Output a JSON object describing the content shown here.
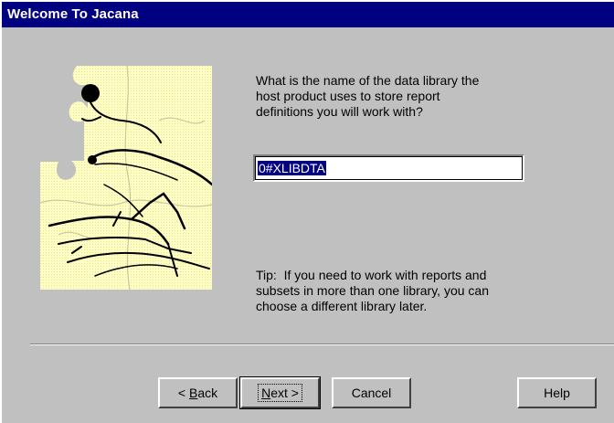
{
  "window": {
    "title": "Welcome To Jacana"
  },
  "question_lines": [
    "What is the name of the data library the",
    "host product uses to store report",
    "definitions you will work with?"
  ],
  "library_field": {
    "value": "0#XLIBDTA"
  },
  "tip_lines": [
    "Tip:  If you need to work with reports and",
    "subsets in more than one library, you can",
    "choose a different library later."
  ],
  "buttons": {
    "back": {
      "prefix": "< ",
      "mnemonic": "B",
      "rest": "ack"
    },
    "next": {
      "mnemonic": "N",
      "rest": "ext >"
    },
    "cancel": "Cancel",
    "help": "Help"
  },
  "colors": {
    "titlebar": "#000080",
    "dialog_bg": "#c0c0c0",
    "art_bg": "#ffffbf",
    "selection": "#000080"
  },
  "icons": {
    "wizard_art": "puzzle-jacana-bird-illustration"
  }
}
